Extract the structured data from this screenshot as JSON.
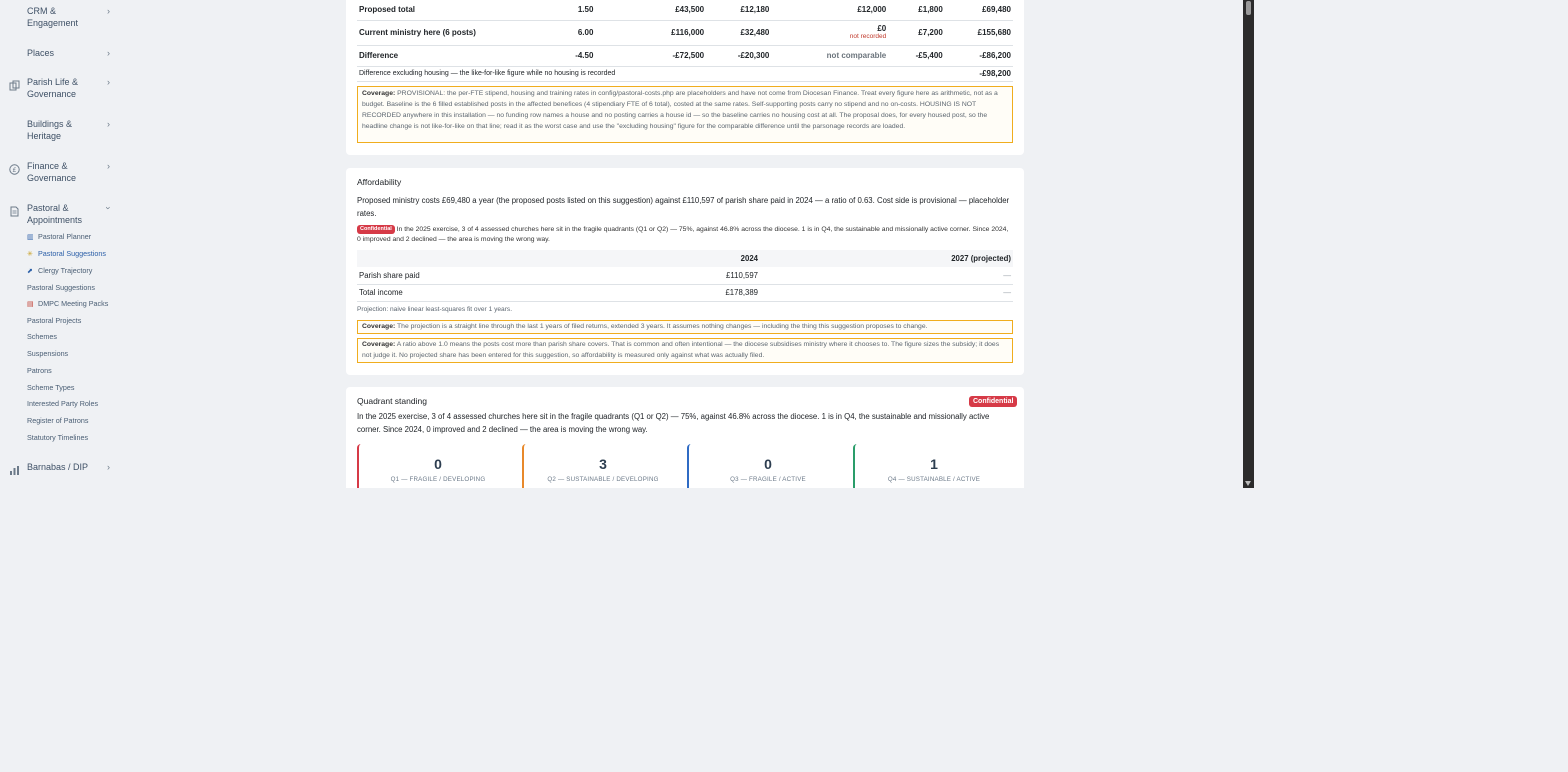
{
  "sidebar": {
    "groups": [
      {
        "label": "CRM & Engagement",
        "icon": "none",
        "expanded": false
      },
      {
        "label": "Places",
        "icon": "none",
        "expanded": false
      },
      {
        "label": "Parish Life & Governance",
        "icon": "copy-icon",
        "expanded": false
      },
      {
        "label": "Buildings & Heritage",
        "icon": "none",
        "expanded": false
      },
      {
        "label": "Finance & Governance",
        "icon": "pound-circle-icon",
        "expanded": false
      },
      {
        "label": "Pastoral & Appointments",
        "icon": "document-icon",
        "expanded": true
      },
      {
        "label": "Barnabas / DIP",
        "icon": "bar-chart-icon",
        "expanded": false
      }
    ],
    "pastoral_items": [
      {
        "label": "Pastoral Planner",
        "icon": "planner-icon",
        "active": false
      },
      {
        "label": "Pastoral Suggestions",
        "icon": "sparkle-icon",
        "active": true
      },
      {
        "label": "Clergy Trajectory",
        "icon": "trend-icon",
        "active": false
      },
      {
        "label": "Pastoral Suggestions",
        "icon": "",
        "active": false
      },
      {
        "label": "DMPC Meeting Packs",
        "icon": "calendar-icon",
        "active": false
      },
      {
        "label": "Pastoral Projects",
        "icon": "",
        "active": false
      },
      {
        "label": "Schemes",
        "icon": "",
        "active": false
      },
      {
        "label": "Suspensions",
        "icon": "",
        "active": false
      },
      {
        "label": "Patrons",
        "icon": "",
        "active": false
      },
      {
        "label": "Scheme Types",
        "icon": "",
        "active": false
      },
      {
        "label": "Interested Party Roles",
        "icon": "",
        "active": false
      },
      {
        "label": "Register of Patrons",
        "icon": "",
        "active": false
      },
      {
        "label": "Statutory Timelines",
        "icon": "",
        "active": false
      }
    ]
  },
  "costs": {
    "rows": [
      {
        "label": "Proposed total",
        "c1": "1.50",
        "c2": "£43,500",
        "c3": "£12,180",
        "c4": "£12,000",
        "c4_note": "",
        "c5": "£1,800",
        "c6": "£69,480",
        "bold": true
      },
      {
        "label": "Current ministry here (6 posts)",
        "c1": "6.00",
        "c2": "£116,000",
        "c3": "£32,480",
        "c4": "£0",
        "c4_note": "not recorded",
        "c5": "£7,200",
        "c6": "£155,680",
        "bold": true
      },
      {
        "label": "Difference",
        "c1": "-4.50",
        "c2": "-£72,500",
        "c3": "-£20,300",
        "c4": "not comparable",
        "c4_note": "",
        "c5": "-£5,400",
        "c6": "-£86,200",
        "bold": true
      },
      {
        "label": "Difference excluding housing — the like-for-like figure while no housing is recorded",
        "c1": "",
        "c2": "",
        "c3": "",
        "c4": "",
        "c4_note": "",
        "c5": "",
        "c6": "-£98,200",
        "bold": false
      }
    ],
    "coverage_label": "Coverage:",
    "coverage_text": "PROVISIONAL: the per-FTE stipend, housing and training rates in config/pastoral-costs.php are placeholders and have not come from Diocesan Finance. Treat every figure here as arithmetic, not as a budget. Baseline is the 6 filled established posts in the affected benefices (4 stipendiary FTE of 6 total), costed at the same rates. Self-supporting posts carry no stipend and no on-costs. HOUSING IS NOT RECORDED anywhere in this installation — no funding row names a house and no posting carries a house id — so the baseline carries no housing cost at all. The proposal does, for every housed post, so the headline change is not like-for-like on that line; read it as the worst case and use the \"excluding housing\" figure for the comparable difference until the parsonage records are loaded."
  },
  "affordability": {
    "title": "Affordability",
    "summary": "Proposed ministry costs £69,480 a year (the proposed posts listed on this suggestion) against £110,597 of parish share paid in 2024 — a ratio of 0.63. Cost side is provisional — placeholder rates.",
    "badge": "Confidential",
    "quadrant_note": "In the 2025 exercise, 3 of 4 assessed churches here sit in the fragile quadrants (Q1 or Q2) — 75%, against 46.8% across the diocese. 1 is in Q4, the sustainable and missionally active corner. Since 2024, 0 improved and 2 declined — the area is moving the wrong way.",
    "table": {
      "col_2024": "2024",
      "col_2027": "2027 (projected)",
      "rows": [
        {
          "label": "Parish share paid",
          "v2024": "£110,597",
          "v2027": "—"
        },
        {
          "label": "Total income",
          "v2024": "£178,389",
          "v2027": "—"
        }
      ]
    },
    "projection_note": "Projection: naive linear least-squares fit over 1 years.",
    "coverage_label": "Coverage:",
    "coverage1": "The projection is a straight line through the last 1 years of filed returns, extended 3 years. It assumes nothing changes — including the thing this suggestion proposes to change.",
    "coverage2": "A ratio above 1.0 means the posts cost more than parish share covers. That is common and often intentional — the diocese subsidises ministry where it chooses to. The figure sizes the subsidy; it does not judge it. No projected share has been entered for this suggestion, so affordability is measured only against what was actually filed."
  },
  "quadrant": {
    "title": "Quadrant standing",
    "badge": "Confidential",
    "text": "In the 2025 exercise, 3 of 4 assessed churches here sit in the fragile quadrants (Q1 or Q2) — 75%, against 46.8% across the diocese. 1 is in Q4, the sustainable and missionally active corner. Since 2024, 0 improved and 2 declined — the area is moving the wrong way.",
    "boxes": [
      {
        "count": "0",
        "label": "Q1 — FRAGILE / DEVELOPING",
        "color": "#d63a47"
      },
      {
        "count": "3",
        "label": "Q2 — SUSTAINABLE / DEVELOPING",
        "color": "#e8892b"
      },
      {
        "count": "0",
        "label": "Q3 — FRAGILE / ACTIVE",
        "color": "#2f6bc4"
      },
      {
        "count": "1",
        "label": "Q4 — SUSTAINABLE / ACTIVE",
        "color": "#2a9d6a"
      }
    ]
  }
}
